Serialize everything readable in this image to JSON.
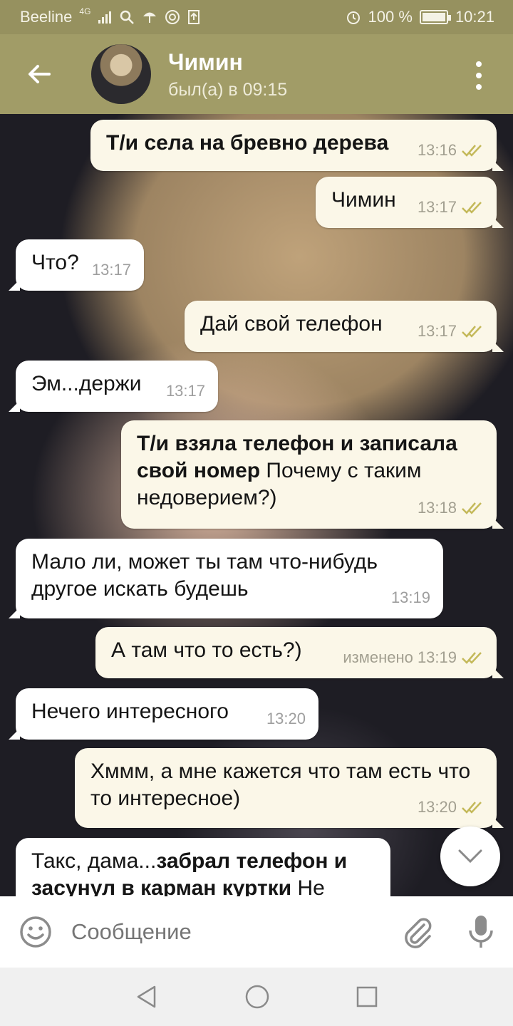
{
  "status_bar": {
    "carrier": "Beeline",
    "network": "4G",
    "battery": "100 %",
    "battery_level": 1.0,
    "time": "10:21"
  },
  "header": {
    "name": "Чимин",
    "status": "был(а) в 09:15"
  },
  "messages": [
    {
      "dir": "out",
      "time": "13:16",
      "parts": [
        {
          "t": "Т/и села на бревно дерева",
          "b": true
        }
      ]
    },
    {
      "dir": "out",
      "time": "13:17",
      "parts": [
        {
          "t": "Чимин",
          "b": false
        }
      ]
    },
    {
      "dir": "in",
      "time": "13:17",
      "parts": [
        {
          "t": "Что?",
          "b": false
        }
      ]
    },
    {
      "dir": "out",
      "time": "13:17",
      "parts": [
        {
          "t": "Дай свой телефон",
          "b": false
        }
      ]
    },
    {
      "dir": "in",
      "time": "13:17",
      "parts": [
        {
          "t": "Эм...держи",
          "b": false
        }
      ]
    },
    {
      "dir": "out",
      "time": "13:18",
      "parts": [
        {
          "t": "Т/и взяла телефон и записала свой номер",
          "b": true
        },
        {
          "t": " Почему с таким недоверием?)",
          "b": false
        }
      ]
    },
    {
      "dir": "in",
      "time": "13:19",
      "parts": [
        {
          "t": "Мало ли, может ты там что-нибудь другое искать будешь",
          "b": false
        }
      ]
    },
    {
      "dir": "out",
      "time": "изменено 13:19",
      "parts": [
        {
          "t": "А там что то есть?)",
          "b": false
        }
      ]
    },
    {
      "dir": "in",
      "time": "13:20",
      "parts": [
        {
          "t": "Нечего интересного",
          "b": false
        }
      ]
    },
    {
      "dir": "out",
      "time": "13:20",
      "parts": [
        {
          "t": "Хммм, а мне кажется что там есть что то интересное)",
          "b": false
        }
      ]
    },
    {
      "dir": "in",
      "time": "",
      "parts": [
        {
          "t": "Такс, дама...",
          "b": false
        },
        {
          "t": "забрал телефон и засунул в карман куртки",
          "b": true
        },
        {
          "t": " Не",
          "b": false
        }
      ]
    }
  ],
  "input": {
    "placeholder": "Сообщение"
  },
  "colors": {
    "header": "#a19c67",
    "status_bar": "#96915f",
    "outgoing_bubble": "#fbf7e8",
    "incoming_bubble": "#ffffff",
    "read_check": "#c4b95a"
  },
  "icons": [
    "back-arrow-icon",
    "menu-dots-icon",
    "emoji-icon",
    "attach-icon",
    "mic-icon",
    "chevron-down-icon",
    "nav-back-icon",
    "nav-home-icon",
    "nav-recents-icon"
  ]
}
